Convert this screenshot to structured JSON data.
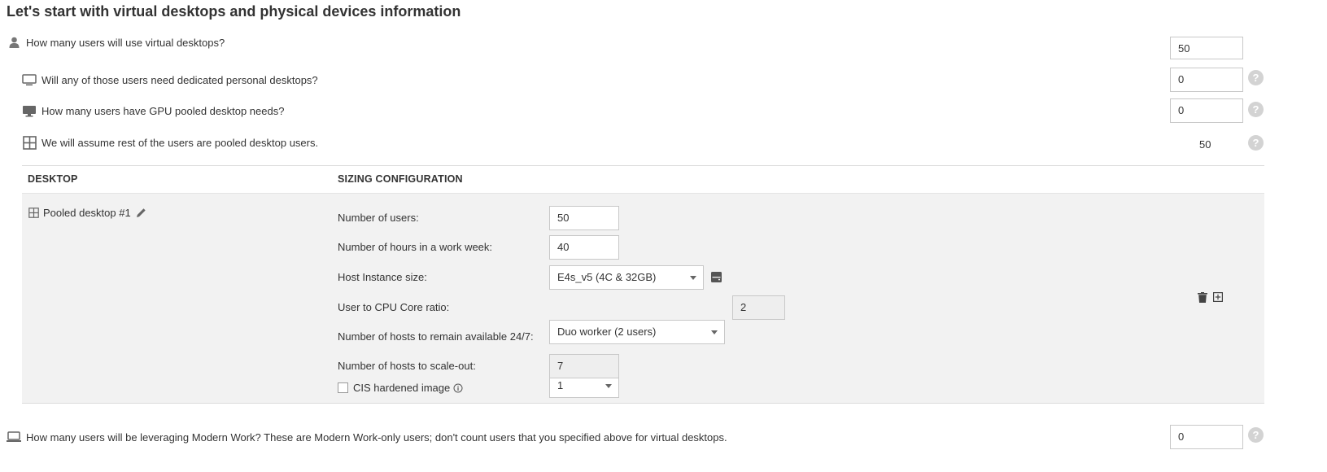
{
  "title": "Let's start with virtual desktops and physical devices information",
  "questions": {
    "total_users": {
      "label": "How many users will use virtual desktops?",
      "value": "50",
      "icon": "user-icon"
    },
    "dedicated": {
      "label": "Will any of those users need dedicated personal desktops?",
      "value": "0",
      "icon": "monitor-icon"
    },
    "gpu": {
      "label": "How many users have GPU pooled desktop needs?",
      "value": "0",
      "icon": "monitor-filled-icon"
    },
    "pooled": {
      "label": "We will assume rest of the users are pooled desktop users.",
      "value": "50",
      "icon": "grid-icon"
    },
    "modern_work": {
      "label": "How many users will be leveraging Modern Work? These are Modern Work-only users; don't count users that you specified above for virtual desktops.",
      "value": "0",
      "icon": "laptop-icon"
    }
  },
  "help_symbol": "?",
  "table": {
    "col_desktop": "DESKTOP",
    "col_sizing": "SIZING CONFIGURATION"
  },
  "desktop": {
    "name": "Pooled desktop #1",
    "fields": {
      "users_label": "Number of users:",
      "users_value": "50",
      "hours_label": "Number of hours in a work week:",
      "hours_value": "40",
      "instance_label": "Host Instance size:",
      "instance_value": "E4s_v5 (4C & 32GB)",
      "ratio_label": "User to CPU Core ratio:",
      "ratio_value": "Duo worker (2 users)",
      "ratio_number": "2",
      "avail_label": "Number of hosts to remain available 24/7:",
      "avail_value": "1",
      "scale_label": "Number of hosts to scale-out:",
      "scale_value": "7",
      "cis_label": "CIS hardened image"
    }
  },
  "colors": {
    "panel": "#f2f2f2",
    "help": "#d3d3d3",
    "text": "#333333"
  }
}
